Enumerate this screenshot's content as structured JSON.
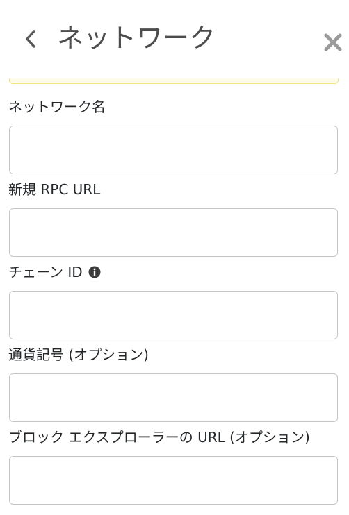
{
  "header": {
    "back_icon": "chevron-left-icon",
    "title": "ネットワーク",
    "close_icon": "close-icon"
  },
  "form": {
    "network_name": {
      "label": "ネットワーク名",
      "value": ""
    },
    "rpc_url": {
      "label": "新規 RPC URL",
      "value": ""
    },
    "chain_id": {
      "label": "チェーン ID",
      "info_icon": "info-icon",
      "value": ""
    },
    "symbol": {
      "label": "通貨記号 (オプション)",
      "value": ""
    },
    "explorer_url": {
      "label": "ブロック エクスプローラーの URL (オプション)",
      "value": ""
    }
  },
  "colors": {
    "text": "#24272a",
    "title": "#4d4d4d",
    "input_border": "#c6c6c6",
    "warning_border": "#f3e47c",
    "icon": "#9b9b9b"
  }
}
